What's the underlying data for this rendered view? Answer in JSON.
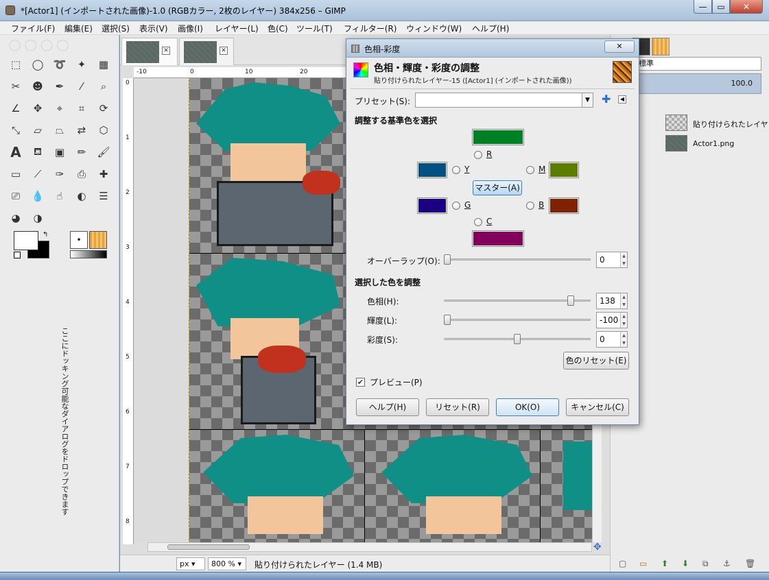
{
  "window": {
    "title": "*[Actor1] (インポートされた画像)-1.0 (RGBカラー, 2枚のレイヤー) 384x256 – GIMP",
    "min_glyph": "—",
    "max_glyph": "▭",
    "close_glyph": "✕"
  },
  "menu": [
    "ファイル(F)",
    "編集(E)",
    "選択(S)",
    "表示(V)",
    "画像(I)",
    "レイヤー(L)",
    "色(C)",
    "ツール(T)",
    "フィルター(R)",
    "ウィンドウ(W)",
    "ヘルプ(H)"
  ],
  "toolbox": {
    "dock_hint": "ここにドッキング可能なダイアログをドロップできます"
  },
  "image_window": {
    "tab_close_glyph": "✕",
    "ruler_h": [
      "-10",
      "0",
      "10",
      "20"
    ],
    "ruler_v": [
      "0",
      "1",
      "2",
      "3",
      "4",
      "5",
      "6",
      "7",
      "8"
    ],
    "unit": "px",
    "zoom": "800 %",
    "status": "貼り付けられたレイヤー (1.4 MB)"
  },
  "right_dock": {
    "mode": "標準",
    "opacity": "100.0",
    "layers": [
      {
        "name": "貼り付けられたレイヤ"
      },
      {
        "name": "Actor1.png"
      }
    ]
  },
  "dialog": {
    "title": "色相-彩度",
    "close_glyph": "✕",
    "header_title": "色相・輝度・彩度の調整",
    "header_subtitle": "貼り付けられたレイヤー-15 ([Actor1] (インポートされた画像))",
    "preset_label": "プリセット(S):",
    "preset_value": "",
    "section_primary": "調整する基準色を選択",
    "colors": {
      "R": {
        "label": "R",
        "swatch": "#008024"
      },
      "Y": {
        "label": "Y",
        "swatch": "#035081"
      },
      "M": {
        "label": "M",
        "swatch": "#5d7d00"
      },
      "G": {
        "label": "G",
        "swatch": "#1a0080"
      },
      "B": {
        "label": "B",
        "swatch": "#7f2200"
      },
      "C": {
        "label": "C",
        "swatch": "#80005a"
      }
    },
    "master_label": "マスター(A)",
    "overlap": {
      "label": "オーバーラップ(O):",
      "value": "0"
    },
    "section_adjust": "選択した色を調整",
    "hue": {
      "label": "色相(H):",
      "value": "138",
      "level": 138,
      "min": -180,
      "max": 180
    },
    "lightness": {
      "label": "輝度(L):",
      "value": "-100",
      "level": -100,
      "min": -100,
      "max": 100
    },
    "saturation": {
      "label": "彩度(S):",
      "value": "0",
      "level": 0,
      "min": -100,
      "max": 100
    },
    "reset_color_label": "色のリセット(E)",
    "preview_label": "プレビュー(P)",
    "preview_checked": true,
    "buttons": {
      "help": "ヘルプ(H)",
      "reset": "リセット(R)",
      "ok": "OK(O)",
      "cancel": "キャンセル(C)"
    }
  }
}
